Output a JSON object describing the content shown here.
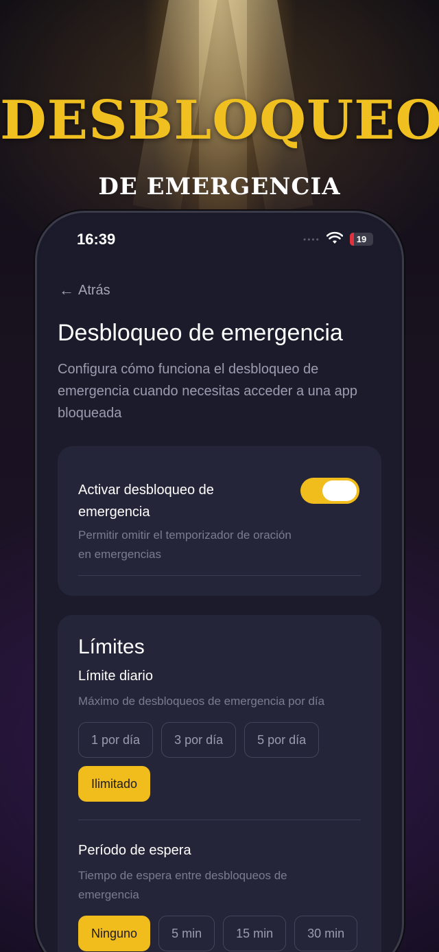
{
  "banner": {
    "headline": "DESBLOQUEO",
    "subheadline": "DE EMERGENCIA",
    "accent_color": "#f0c020"
  },
  "status_bar": {
    "time": "16:39",
    "signal_icon": "signal-dots-icon",
    "wifi_icon": "wifi-icon",
    "battery_level": "19",
    "battery_fraction": 0.19,
    "battery_color": "#e0323c"
  },
  "nav": {
    "back_icon": "arrow-left-icon",
    "back_label": "Atrás"
  },
  "page": {
    "title": "Desbloqueo de emergencia",
    "description": "Configura cómo funciona el desbloqueo de emergencia cuando necesitas acceder a una app bloqueada"
  },
  "emergency_toggle": {
    "label": "Activar desbloqueo de emergencia",
    "description": "Permitir omitir el temporizador de oración en emergencias",
    "enabled": true,
    "on_color": "#f1bd1c"
  },
  "limits": {
    "title": "Límites",
    "daily": {
      "label": "Límite diario",
      "hint": "Máximo de desbloqueos de emergencia por día",
      "options": [
        "1 por día",
        "3 por día",
        "5 por día",
        "Ilimitado"
      ],
      "selected": "Ilimitado"
    },
    "cooldown": {
      "label": "Período de espera",
      "hint": "Tiempo de espera entre desbloqueos de emergencia",
      "options": [
        "Ninguno",
        "5 min",
        "15 min",
        "30 min"
      ],
      "selected": "Ninguno"
    }
  }
}
